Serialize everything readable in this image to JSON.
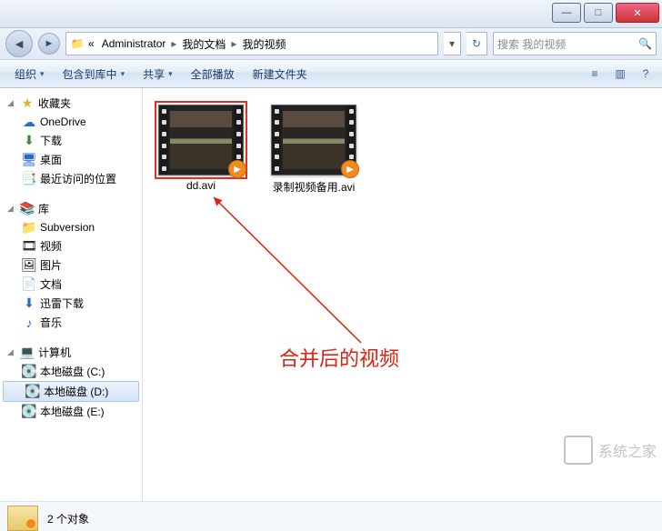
{
  "window": {
    "min_icon": "—",
    "max_icon": "□",
    "close_icon": "✕"
  },
  "address": {
    "back_icon": "◄",
    "fwd_icon": "►",
    "prefix_icon": "📁",
    "overflow": "«",
    "crumb1": "Administrator",
    "crumb2": "我的文档",
    "crumb3": "我的视频",
    "sep": "▸",
    "history_icon": "▾",
    "refresh_icon": "↻"
  },
  "search": {
    "placeholder": "搜索 我的视频",
    "icon": "🔍"
  },
  "toolbar": {
    "organize": "组织",
    "include": "包含到库中",
    "share": "共享",
    "play_all": "全部播放",
    "new_folder": "新建文件夹",
    "dd": "▾",
    "view_icon": "≡",
    "preview_icon": "▥",
    "help_icon": "?"
  },
  "sidebar": {
    "favorites": {
      "label": "收藏夹",
      "icon": "★",
      "expander": "◢"
    },
    "fav_items": [
      {
        "label": "OneDrive",
        "icon": "☁"
      },
      {
        "label": "下载",
        "icon": "⬇"
      },
      {
        "label": "桌面",
        "icon": "🖥"
      },
      {
        "label": "最近访问的位置",
        "icon": "📑"
      }
    ],
    "libraries": {
      "label": "库",
      "icon": "📚",
      "expander": "◢"
    },
    "lib_items": [
      {
        "label": "Subversion",
        "icon": "📁"
      },
      {
        "label": "视频",
        "icon": "🎞"
      },
      {
        "label": "图片",
        "icon": "🖼"
      },
      {
        "label": "文档",
        "icon": "📄"
      },
      {
        "label": "迅雷下载",
        "icon": "⬇"
      },
      {
        "label": "音乐",
        "icon": "♪"
      }
    ],
    "computer": {
      "label": "计算机",
      "icon": "💻",
      "expander": "◢"
    },
    "drives": [
      {
        "label": "本地磁盘 (C:)",
        "icon": "💽"
      },
      {
        "label": "本地磁盘 (D:)",
        "icon": "💽",
        "selected": true
      },
      {
        "label": "本地磁盘 (E:)",
        "icon": "💽"
      }
    ]
  },
  "files": [
    {
      "name": "dd.avi",
      "selected": true
    },
    {
      "name": "录制视频备用.avi",
      "selected": false
    }
  ],
  "annotation": {
    "text": "合并后的视频"
  },
  "statusbar": {
    "text": "2 个对象"
  },
  "watermark": {
    "text": "系统之家"
  }
}
